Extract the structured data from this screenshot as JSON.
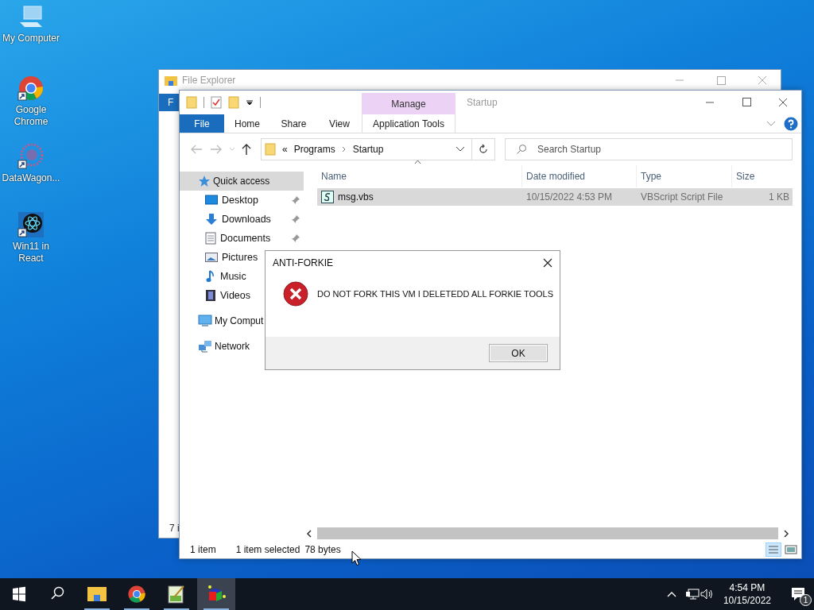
{
  "desktop_icons": [
    {
      "label": "My Computer",
      "kind": "computer"
    },
    {
      "label": "Google Chrome",
      "kind": "chrome"
    },
    {
      "label": "DataWagon...",
      "kind": "datawagon"
    },
    {
      "label": "Win11 in React",
      "kind": "react"
    }
  ],
  "back_window": {
    "title": "File Explorer",
    "ribbon_tab": "F",
    "status": "7 i"
  },
  "explorer": {
    "title": "Startup",
    "context_group": "Manage",
    "tabs": [
      {
        "label": "File",
        "kind": "file"
      },
      {
        "label": "Home",
        "kind": "plain"
      },
      {
        "label": "Share",
        "kind": "plain"
      },
      {
        "label": "View",
        "kind": "plain"
      },
      {
        "label": "Application Tools",
        "kind": "context"
      }
    ],
    "address_prefix": "«",
    "address": [
      "Programs",
      "Startup"
    ],
    "search": {
      "placeholder": "Search Startup"
    },
    "nav": [
      {
        "label": "Quick access",
        "kind": "star",
        "selected": true,
        "children": [
          {
            "label": "Desktop",
            "kind": "desktop",
            "pinned": true,
            "selected": false
          },
          {
            "label": "Downloads",
            "kind": "download",
            "pinned": true,
            "selected": false
          },
          {
            "label": "Documents",
            "kind": "document",
            "pinned": true,
            "selected": false
          },
          {
            "label": "Pictures",
            "kind": "pictures",
            "pinned": false,
            "selected": false
          },
          {
            "label": "Music",
            "kind": "music",
            "pinned": false,
            "selected": false
          },
          {
            "label": "Videos",
            "kind": "videos",
            "pinned": false,
            "selected": false
          }
        ]
      },
      {
        "label": "My Comput",
        "kind": "computer",
        "selected": false
      },
      {
        "label": "Network",
        "kind": "network",
        "selected": false
      }
    ],
    "columns": [
      "Name",
      "Date modified",
      "Type",
      "Size"
    ],
    "files": [
      {
        "name": "msg.vbs",
        "date": "10/15/2022 4:53 PM",
        "type": "VBScript Script File",
        "size": "1 KB",
        "selected": true
      }
    ],
    "status": [
      "1 item",
      "1 item selected",
      "78 bytes"
    ]
  },
  "dialog": {
    "title": "ANTI-FORKIE",
    "message": "DO NOT FORK THIS VM I DELETEDD ALL FORKIE TOOLS",
    "button": "OK"
  },
  "taskbar": {
    "apps": [
      {
        "kind": "explorer",
        "running": true,
        "active": false
      },
      {
        "kind": "chrome",
        "running": true,
        "active": false
      },
      {
        "kind": "notepad",
        "running": true,
        "active": false
      },
      {
        "kind": "cube",
        "running": true,
        "active": true
      }
    ],
    "time": "4:54 PM",
    "date": "10/15/2022",
    "notifications": "1"
  }
}
